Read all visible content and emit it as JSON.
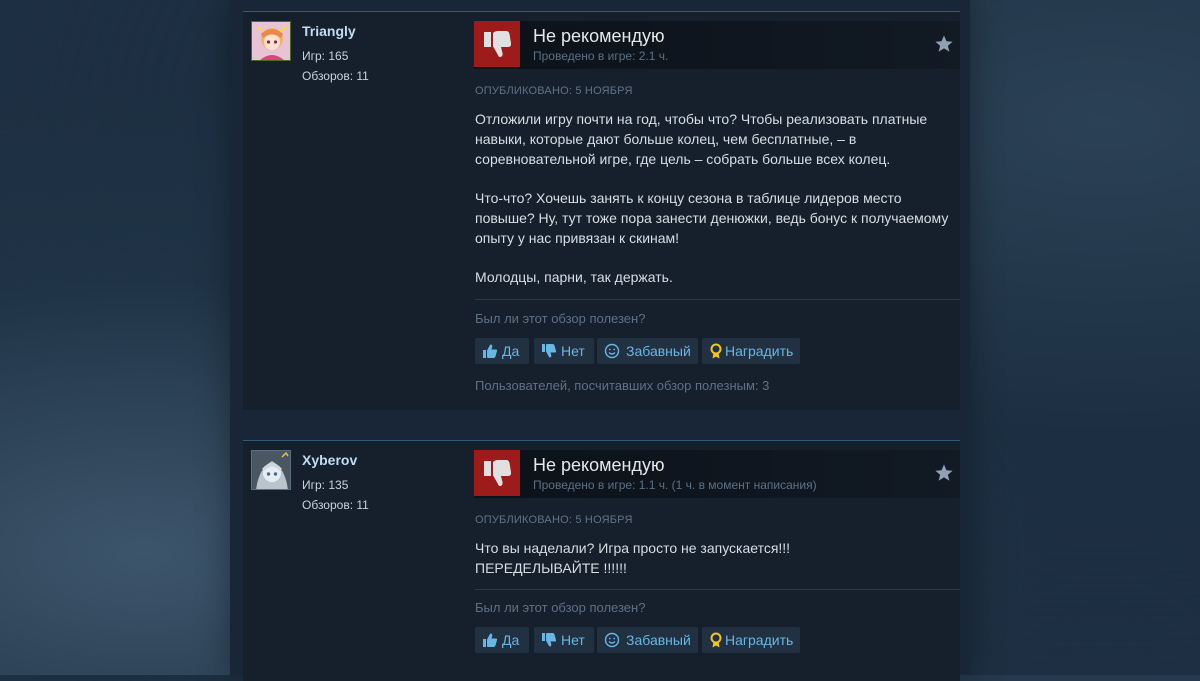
{
  "reviews": [
    {
      "author": {
        "name": "Triangly",
        "games": "Игр: 165",
        "reviews": "Обзоров: 11"
      },
      "vote": "Не рекомендую",
      "playtime": "Проведено в игре: 2.1 ч.",
      "posted": "ОПУБЛИКОВАНО: 5 НОЯБРЯ",
      "paragraphs": [
        "Отложили игру почти на год, чтобы что? Чтобы реализовать платные навыки, которые дают больше колец, чем бесплатные, – в соревновательной игре, где цель – собрать больше всех колец.",
        "Что-что? Хочешь занять к концу сезона в таблице лидеров место повыше? Ну, тут тоже пора занести денюжки, ведь бонус к получаемому опыту у нас привязан к скинам!",
        "Молодцы, парни, так держать."
      ],
      "helpful_question": "Был ли этот обзор полезен?",
      "buttons": {
        "yes": "Да",
        "no": "Нет",
        "funny": "Забавный",
        "award": "Наградить"
      },
      "helpful_count": "Пользователей, посчитавших обзор полезным: 3"
    },
    {
      "author": {
        "name": "Xyberov",
        "games": "Игр: 135",
        "reviews": "Обзоров: 11"
      },
      "vote": "Не рекомендую",
      "playtime": "Проведено в игре: 1.1 ч. (1 ч. в момент написания)",
      "posted": "ОПУБЛИКОВАНО: 5 НОЯБРЯ",
      "paragraphs": [
        "Что вы наделали? Игра просто не запускается!!! ПЕРЕДЕЛЫВАЙТЕ !!!!!!"
      ],
      "helpful_question": "Был ли этот обзор полезен?",
      "buttons": {
        "yes": "Да",
        "no": "Нет",
        "funny": "Забавный",
        "award": "Наградить"
      }
    }
  ],
  "colors": {
    "not_recommended": "#9e1b1b",
    "link": "#68b6e6",
    "author_name": "#c1dbf4"
  }
}
